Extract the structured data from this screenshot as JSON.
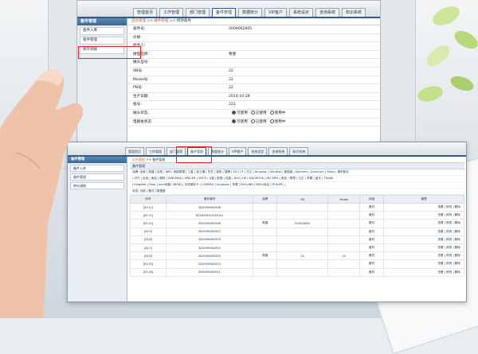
{
  "top_screen": {
    "nav_tabs": [
      "管理首页",
      "工作管理",
      "部门管理",
      "备件管理",
      "数据统计",
      "VIP客户",
      "系统设定",
      "咨询系统",
      "知识系统"
    ],
    "active_tab_index": 3,
    "sidebar": {
      "title": "备件管理",
      "items": [
        "备件入库",
        "备件管理",
        "库存调拨"
      ]
    },
    "breadcrumb": {
      "home": "后台管理",
      "section": "备件管理",
      "page": "修改备件",
      "separator": ">>"
    },
    "form_rows": [
      {
        "label": "备件号:",
        "value": "2009062905"
      },
      {
        "label": "价格:",
        "value": ""
      },
      {
        "label": "经手人:",
        "value": ""
      },
      {
        "label": "硬盘品牌:",
        "value": "希捷"
      },
      {
        "label": "磁头型号:",
        "value": ""
      },
      {
        "label": "SN号:",
        "value": "22"
      },
      {
        "label": "Model号:",
        "value": "22"
      },
      {
        "label": "PN号:",
        "value": "22"
      },
      {
        "label": "生产日期:",
        "value": "2014-10-28"
      },
      {
        "label": "板号:",
        "value": "222"
      },
      {
        "label": "磁头状态:",
        "value": "",
        "radios": [
          "可使用",
          "已使用",
          "使用中"
        ],
        "selected": 0
      },
      {
        "label": "电路板状态:",
        "value": "",
        "radios": [
          "可使用",
          "已使用",
          "使用中"
        ],
        "selected": 0
      }
    ]
  },
  "bottom_screen": {
    "nav_tabs": [
      "管理首页",
      "工作管理",
      "部门管理",
      "备件管理",
      "数据统计",
      "VIP客户",
      "系统设定",
      "咨询系统",
      "知识系统"
    ],
    "active_tab_index": 3,
    "sidebar": {
      "title": "备件管理",
      "items": [
        "备件入库",
        "备件管理",
        "库存调拨"
      ]
    },
    "breadcrumb": {
      "home": "后台管理",
      "section": "备件管理",
      "separator": ">>"
    },
    "section_title": "备件管理",
    "brand_filter": "品牌: 全部 | 希捷 | 迈拓 | IBM | 西部数据 | 三星 | 富士通 | 东芝 | 易拓 | 昆腾 | SD | CF | 日立 | Kingston | Sandisk | 爱国者 | Siemens | Quantum | Turbo | 清华紫光",
    "brand_filter_2": "| 中兴 | 台电 | 索尼 | 朗科 | KINGMAX | APACER | SIM卡 | U盘 | 影驰 | 佳能 | Dell | HP | MACBOOK | JNC-MP4 | 索尼 | 联想 | 方正 | 苹果 | 蓝天 | TRANS",
    "brand_filter_3": "| Kingdisk | Frost | acer电脑 | BENQ | 手机储存卡 | COMPAQ | kingspec | 苹果 | BUSLINK | NESO硅谷 | PHILIPS |",
    "status_filter": "状态: 全部 | 备件 | 数据盘",
    "columns": [
      "序号",
      "备件编号",
      "品牌",
      "SN",
      "Model",
      "用途",
      "管理"
    ],
    "rows": [
      {
        "id": "[ID:12]",
        "code": "B20090062908",
        "brand": "",
        "sn": "",
        "model": "",
        "use": "备件",
        "ops": "查看 | 修改 | 删除"
      },
      {
        "id": "[ID:11]",
        "code": "B20090010104001",
        "brand": "",
        "sn": "",
        "model": "",
        "use": "备件",
        "ops": "查看 | 修改 | 删除"
      },
      {
        "id": "[ID:10]",
        "code": "B20090062906",
        "brand": "希捷",
        "sn": "5US45X8V",
        "model": "",
        "use": "备件",
        "ops": "查看 | 修改 | 删除"
      },
      {
        "id": "[ID:9]",
        "code": "B20090062907",
        "brand": "",
        "sn": "",
        "model": "",
        "use": "备件",
        "ops": "查看 | 修改 | 删除"
      },
      {
        "id": "[ID:8]",
        "code": "B20090062903",
        "brand": "",
        "sn": "",
        "model": "",
        "use": "备件",
        "ops": "查看 | 修改 | 删除"
      },
      {
        "id": "[ID:7]",
        "code": "B20090062904",
        "brand": "",
        "sn": "",
        "model": "",
        "use": "备件",
        "ops": "查看 | 修改 | 删除"
      },
      {
        "id": "[ID:6]",
        "code": "B20090062905",
        "brand": "希捷",
        "sn": "22",
        "model": "22",
        "use": "备件",
        "ops": "查看 | 修改 | 删除"
      },
      {
        "id": "[ID:15]",
        "code": "B20090062910",
        "brand": "",
        "sn": "",
        "model": "",
        "use": "备件",
        "ops": "查看 | 修改 | 删除"
      },
      {
        "id": "[ID:16]",
        "code": "B20090062911",
        "brand": "",
        "sn": "",
        "model": "",
        "use": "备件",
        "ops": "查看 | 修改 | 删除"
      }
    ]
  },
  "colors": {
    "nav_accent": "#2d5d8f",
    "highlight": "#e01e24",
    "breadcrumb": "#d4580e"
  }
}
